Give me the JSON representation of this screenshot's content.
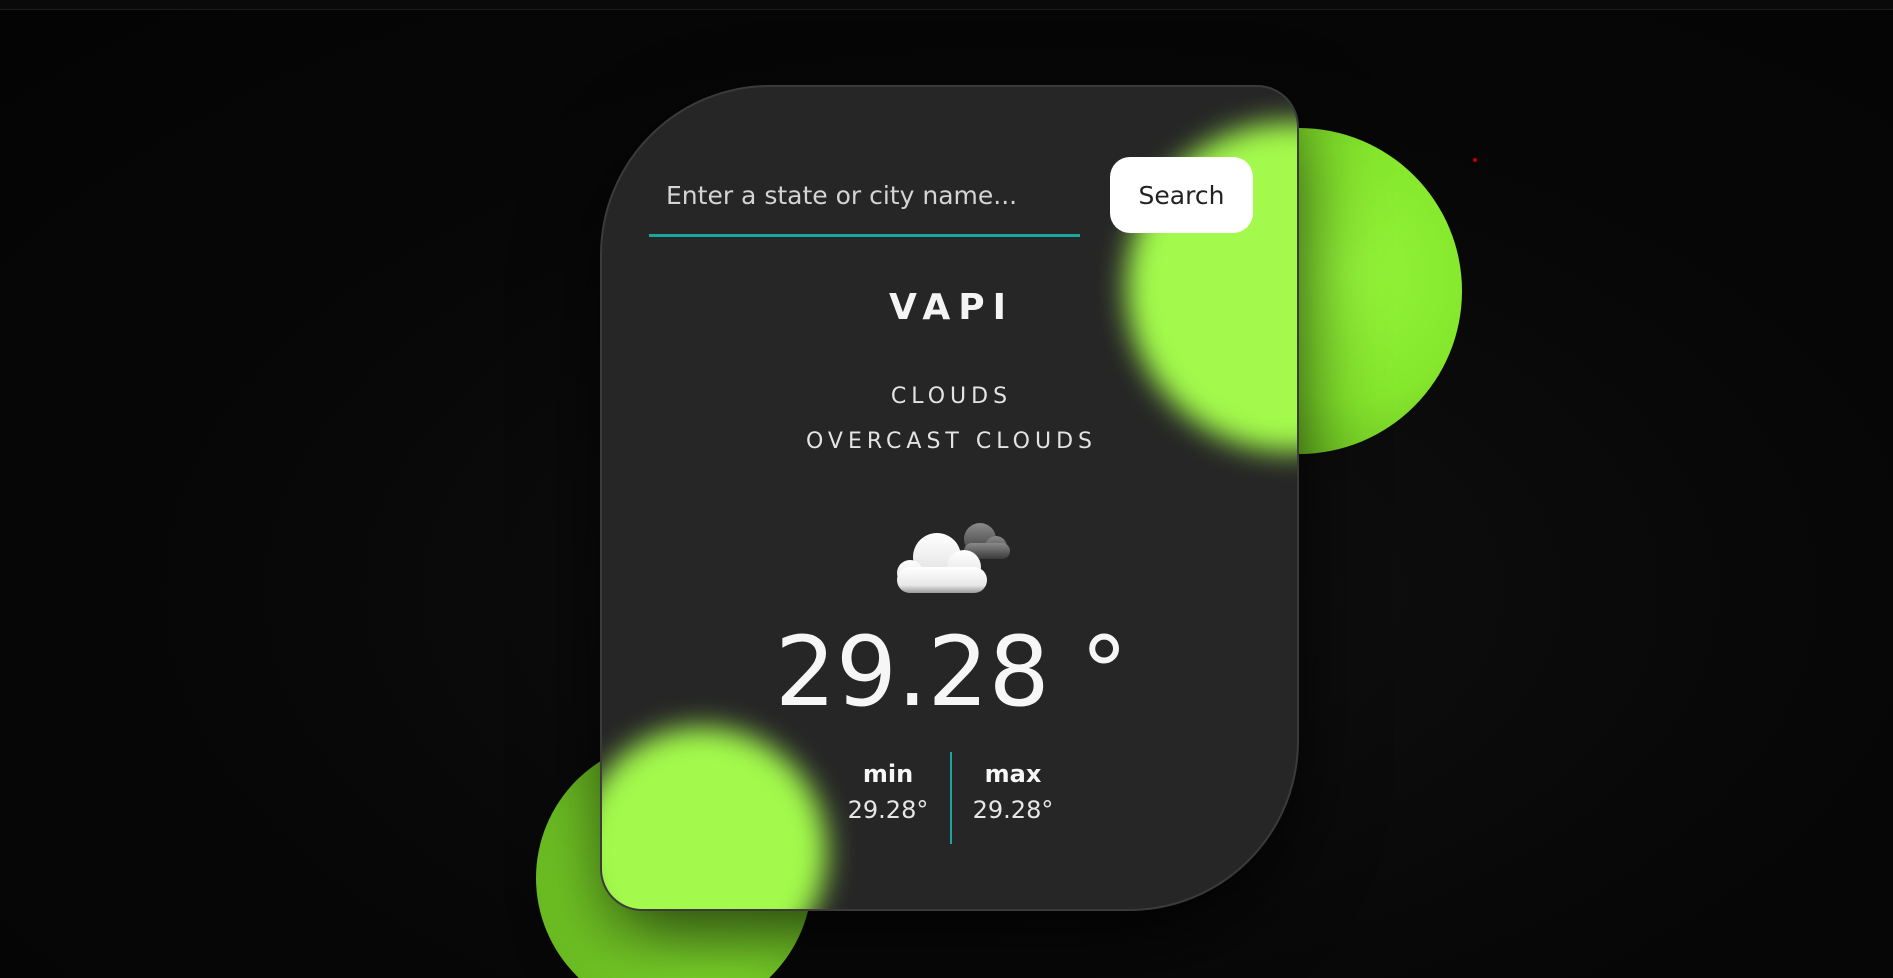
{
  "search": {
    "placeholder": "Enter a state or city name...",
    "value": "",
    "button_label": "Search"
  },
  "weather": {
    "city": "VAPI",
    "condition": "CLOUDS",
    "description": "OVERCAST CLOUDS",
    "icon": "clouds-icon",
    "temperature": "29.28 °",
    "min_label": "min",
    "min_value": "29.28°",
    "max_label": "max",
    "max_value": "29.28°"
  },
  "colors": {
    "background": "#050505",
    "card": "#262626",
    "accent_green": "#a3fa4c",
    "underline_teal": "#1aa79b",
    "button_bg": "#ffffff"
  }
}
